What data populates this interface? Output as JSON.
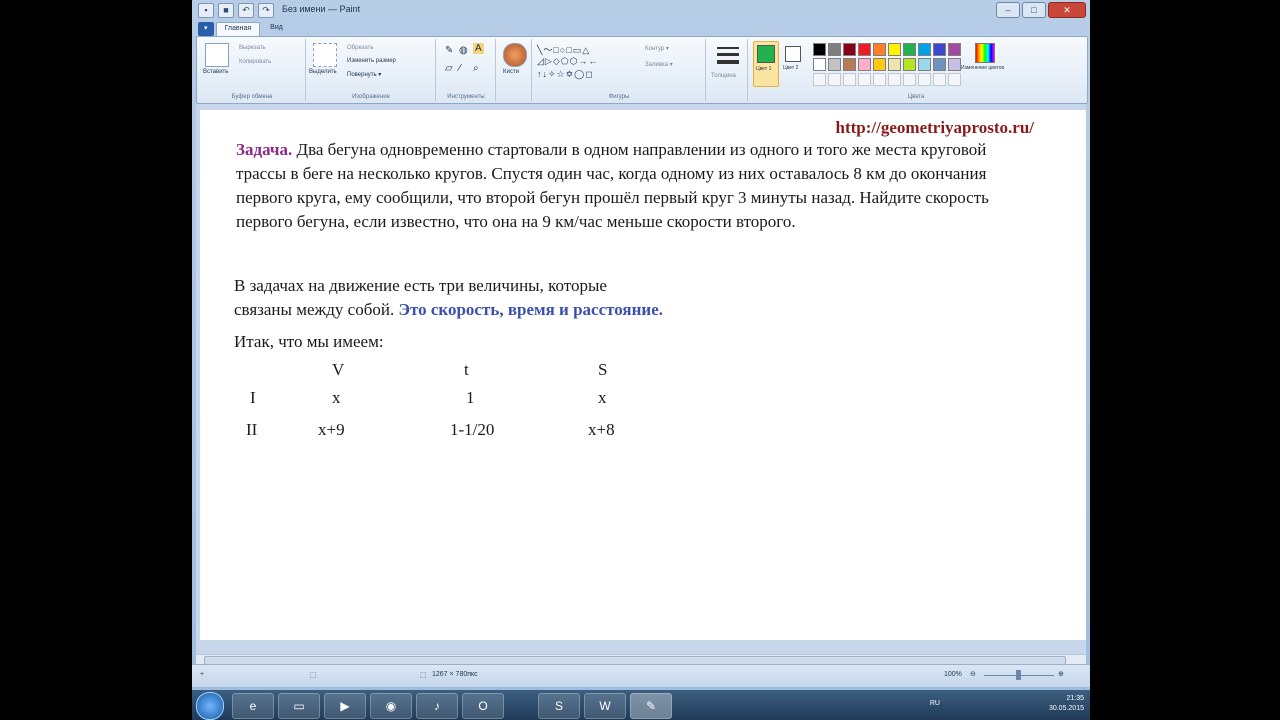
{
  "window": {
    "title": "Без имени — Paint"
  },
  "ribbon": {
    "tabs": [
      "Главная",
      "Вид"
    ],
    "clipboard": {
      "paste": "Вставить",
      "cut": "Вырезать",
      "copy": "Копировать",
      "label": "Буфер обмена"
    },
    "image": {
      "select": "Выделить",
      "crop": "Обрезать",
      "resize": "Изменить размер",
      "rotate": "Повернуть ▾",
      "label": "Изображение"
    },
    "tools": {
      "label": "Инструменты"
    },
    "brushes": {
      "label": "Кисти"
    },
    "shapes": {
      "outline": "Контур ▾",
      "fill": "Заливка ▾",
      "label": "Фигуры"
    },
    "size": {
      "label": "Толщина"
    },
    "colors": {
      "color1": "Цвет 1",
      "color2": "Цвет 2",
      "edit": "Изменение цветов",
      "label": "Цвета"
    }
  },
  "palette": [
    "#000000",
    "#7f7f7f",
    "#880015",
    "#ed1c24",
    "#ff7f27",
    "#fff200",
    "#22b14c",
    "#00a2e8",
    "#3f48cc",
    "#a349a4",
    "#ffffff",
    "#c3c3c3",
    "#b97a57",
    "#ffaec9",
    "#ffc90e",
    "#efe4b0",
    "#b5e61d",
    "#99d9ea",
    "#7092be",
    "#c8bfe7"
  ],
  "document": {
    "url": "http://geometriyaprosto.ru/",
    "task_keyword": "Задача.",
    "task_text": " Два бегуна одновременно стартовали в одном направлении из одного и того же места круговой трассы в беге на несколько кругов. Спустя один час, когда одному из них оставалось 8 км до окончания первого круга, ему сообщили, что второй бегун прошёл первый круг 3 минуты назад. Найдите скорость первого бегуна, если известно, что она на 9 км/час меньше скорости второго.",
    "para_line1": "В задачах на движение есть три величины, которые",
    "para_line2": "связаны между собой. ",
    "para_blue": "Это скорость, время  и расстояние.",
    "itak": "Итак, что мы имеем:",
    "table": {
      "headers": [
        "V",
        "t",
        "S"
      ],
      "rows": [
        {
          "label": "I",
          "v": "x",
          "t": "1",
          "s": "x"
        },
        {
          "label": "II",
          "v": "x+9",
          "t": "1-1/20",
          "s": "x+8"
        }
      ]
    }
  },
  "status": {
    "size": "1267 × 780пкс",
    "zoom": "100%"
  },
  "taskbar": {
    "lang": "RU",
    "time": "21:35",
    "date": "30.05.2015"
  }
}
